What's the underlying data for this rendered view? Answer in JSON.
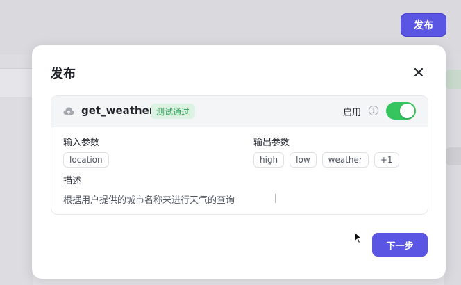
{
  "background": {
    "publish_button": "发布"
  },
  "modal": {
    "title": "发布",
    "close_icon": "close-icon",
    "tool": {
      "icon": "cloud-icon",
      "name": "get_weather",
      "status": "测试通过",
      "enable_label": "启用",
      "enabled": true,
      "input_params_label": "输入参数",
      "input_params": [
        "location"
      ],
      "output_params_label": "输出参数",
      "output_params": [
        "high",
        "low",
        "weather",
        "+1"
      ],
      "description_label": "描述",
      "description": "根据用户提供的城市名称来进行天气的查询"
    },
    "next_button": "下一步"
  },
  "colors": {
    "accent": "#5b55e3",
    "toggle_on": "#36c45e",
    "status_bg": "#dcf3e4",
    "status_text": "#2f9e57"
  }
}
